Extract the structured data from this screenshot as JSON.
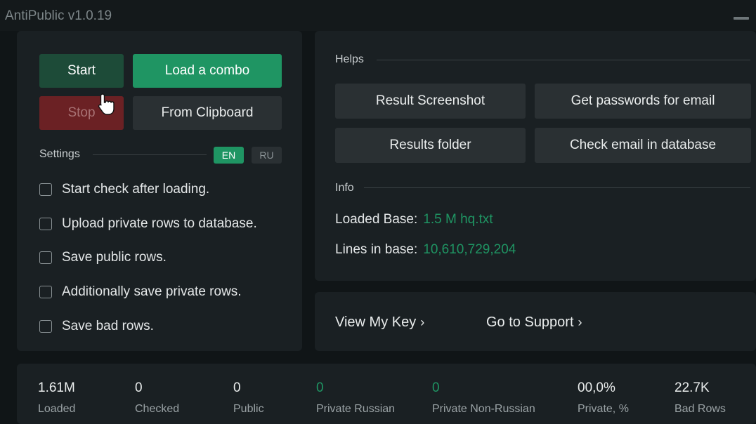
{
  "window": {
    "title": "AntiPublic v1.0.19"
  },
  "controls": {
    "start_label": "Start",
    "load_label": "Load a combo",
    "stop_label": "Stop",
    "clipboard_label": "From Clipboard"
  },
  "settings": {
    "label": "Settings",
    "lang_en": "EN",
    "lang_ru": "RU",
    "options": [
      "Start check after loading.",
      "Upload private rows to database.",
      "Save public rows.",
      "Additionally save private rows.",
      "Save bad rows."
    ]
  },
  "helps": {
    "label": "Helps",
    "buttons": [
      "Result Screenshot",
      "Get passwords for email",
      "Results folder",
      "Check email in database"
    ]
  },
  "info": {
    "label": "Info",
    "loaded_base_label": "Loaded Base:",
    "loaded_base_value": "1.5 M hq.txt",
    "lines_label": "Lines in base:",
    "lines_value": "10,610,729,204"
  },
  "links": {
    "view_key": "View My Key",
    "support": "Go to Support",
    "chevron": "›"
  },
  "stats": [
    {
      "value": "1.61M",
      "label": "Loaded"
    },
    {
      "value": "0",
      "label": "Checked"
    },
    {
      "value": "0",
      "label": "Public"
    },
    {
      "value": "0",
      "label": "Private Russian"
    },
    {
      "value": "0",
      "label": "Private Non-Russian"
    },
    {
      "value": "00,0%",
      "label": "Private, %"
    },
    {
      "value": "22.7K",
      "label": "Bad Rows"
    }
  ],
  "colors": {
    "accent": "#1f9563",
    "stop": "#6b2124",
    "panel": "#1a2023",
    "background": "#101517"
  }
}
